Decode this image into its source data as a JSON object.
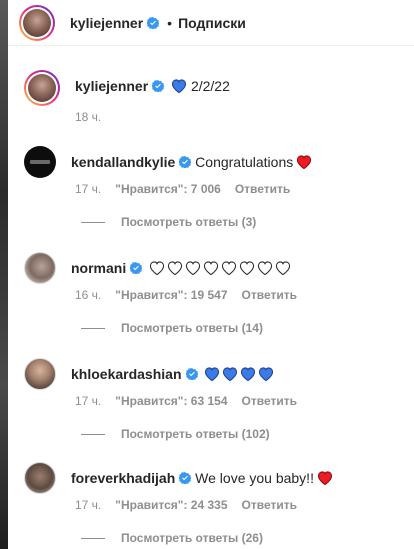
{
  "header": {
    "username": "kyliejenner",
    "separator": "•",
    "follow_label": "Подписки"
  },
  "caption": {
    "username": "kyliejenner",
    "text": "2/2/22",
    "emoji": [
      "blue-heart"
    ],
    "time": "18 ч."
  },
  "comments": [
    {
      "username": "kendallandkylie",
      "text": "Congratulations",
      "emoji": [
        "red-heart"
      ],
      "time": "17 ч.",
      "likes": "\"Нравится\": 7 006",
      "reply": "Ответить",
      "view_replies": "Посмотреть ответы (3)"
    },
    {
      "username": "normani",
      "text": "",
      "emoji": [
        "white-heart",
        "white-heart",
        "white-heart",
        "white-heart",
        "white-heart",
        "white-heart",
        "white-heart",
        "white-heart"
      ],
      "time": "16 ч.",
      "likes": "\"Нравится\": 19 547",
      "reply": "Ответить",
      "view_replies": "Посмотреть ответы (14)"
    },
    {
      "username": "khloekardashian",
      "text": "",
      "emoji": [
        "blue-heart",
        "blue-heart",
        "blue-heart",
        "blue-heart"
      ],
      "time": "17 ч.",
      "likes": "\"Нравится\": 63 154",
      "reply": "Ответить",
      "view_replies": "Посмотреть ответы (102)"
    },
    {
      "username": "foreverkhadijah",
      "text": "We love you baby!!",
      "emoji": [
        "red-heart"
      ],
      "time": "17 ч.",
      "likes": "\"Нравится\": 24 335",
      "reply": "Ответить",
      "view_replies": "Посмотреть ответы (26)"
    }
  ],
  "colors": {
    "verified": "#3897f0",
    "blue_heart": "#3b7be8",
    "red_heart": "#ed1c24",
    "muted_text": "#8e8e8e",
    "primary_text": "#262626"
  }
}
